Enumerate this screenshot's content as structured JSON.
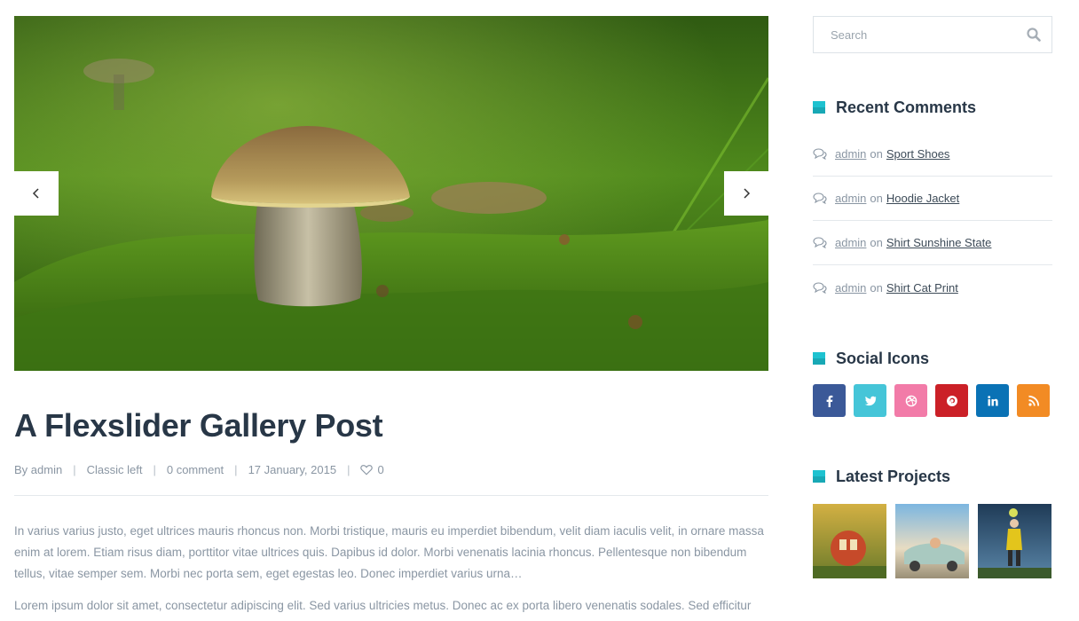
{
  "post": {
    "title": "A Flexslider Gallery Post",
    "meta": {
      "by_label": "By",
      "author": "admin",
      "category": "Classic left",
      "comments": "0 comment",
      "date": "17 January, 2015",
      "likes": "0",
      "separator": "|"
    },
    "excerpt": [
      "In varius varius justo, eget ultrices mauris rhoncus non. Morbi tristique, mauris eu imperdiet bibendum, velit diam iaculis velit, in ornare massa enim at lorem. Etiam risus diam, porttitor vitae ultrices quis. Dapibus id dolor. Morbi venenatis lacinia rhoncus. Pellentesque non bibendum tellus, vitae semper sem. Morbi nec porta sem, eget egestas leo. Donec imperdiet varius urna…",
      "Lorem ipsum dolor sit amet, consectetur adipiscing elit. Sed varius ultricies metus. Donec ac ex porta libero venenatis sodales. Sed efficitur"
    ],
    "slider": {
      "prev_icon": "chevron-left-icon",
      "next_icon": "chevron-right-icon"
    }
  },
  "sidebar": {
    "search": {
      "placeholder": "Search",
      "value": "",
      "icon": "search-icon"
    },
    "recent_comments": {
      "title": "Recent Comments",
      "connector": "on",
      "items": [
        {
          "author": "admin",
          "post": "Sport Shoes"
        },
        {
          "author": "admin",
          "post": "Hoodie Jacket"
        },
        {
          "author": "admin",
          "post": "Shirt Sunshine State"
        },
        {
          "author": "admin",
          "post": "Shirt Cat Print"
        }
      ]
    },
    "social": {
      "title": "Social Icons",
      "items": [
        {
          "name": "facebook",
          "icon": "facebook-icon",
          "color": "#3b5998"
        },
        {
          "name": "twitter",
          "icon": "twitter-icon",
          "color": "#45c5d8"
        },
        {
          "name": "dribbble",
          "icon": "dribbble-icon",
          "color": "#f27ba8"
        },
        {
          "name": "pinterest",
          "icon": "pinterest-icon",
          "color": "#cb2027"
        },
        {
          "name": "linkedin",
          "icon": "linkedin-icon",
          "color": "#0a72b5"
        },
        {
          "name": "rss",
          "icon": "rss-icon",
          "color": "#f28b24"
        }
      ]
    },
    "projects": {
      "title": "Latest Projects"
    }
  },
  "colors": {
    "accent": "#1ec2d0",
    "heading": "#283747",
    "muted": "#8a96a3"
  }
}
